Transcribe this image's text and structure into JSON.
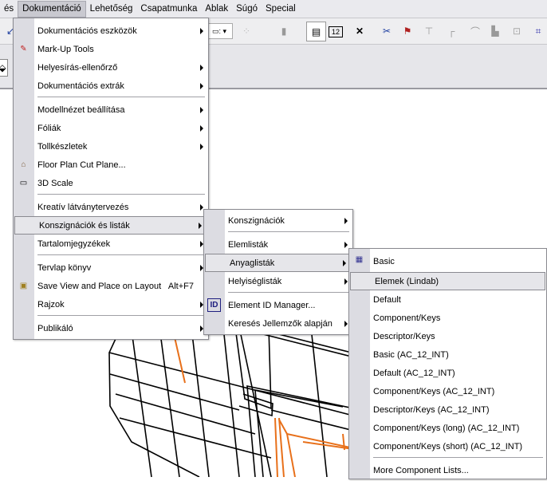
{
  "menubar": {
    "items": [
      "és",
      "Dokumentáció",
      "Lehetőség",
      "Csapatmunka",
      "Ablak",
      "Súgó",
      "Special"
    ],
    "active": "Dokumentáció"
  },
  "main_menu": {
    "items": [
      {
        "label": "Dokumentációs eszközök",
        "submenu": true
      },
      {
        "label": "Mark-Up Tools",
        "icon": "markup-pen-icon"
      },
      {
        "label": "Helyesírás-ellenőrző",
        "submenu": true
      },
      {
        "label": "Dokumentációs extrák",
        "submenu": true
      },
      {
        "separator": true
      },
      {
        "label": "Modellnézet beállítása",
        "submenu": true
      },
      {
        "label": "Fóliák",
        "submenu": true
      },
      {
        "label": "Tollkészletek",
        "submenu": true
      },
      {
        "label": "Floor Plan Cut Plane...",
        "icon": "cut-plane-icon"
      },
      {
        "label": "3D Scale",
        "icon": "ruler-icon"
      },
      {
        "separator": true
      },
      {
        "label": "Kreatív látványtervezés",
        "submenu": true
      },
      {
        "label": "Konszignációk és listák",
        "submenu": true,
        "highlighted": true
      },
      {
        "label": "Tartalomjegyzékek",
        "submenu": true
      },
      {
        "separator": true
      },
      {
        "label": "Tervlap könyv",
        "submenu": true
      },
      {
        "label": "Save View and Place on Layout",
        "shortcut": "Alt+F7",
        "icon": "save-view-icon"
      },
      {
        "label": "Rajzok",
        "submenu": true
      },
      {
        "separator": true
      },
      {
        "label": "Publikáló",
        "submenu": true
      }
    ]
  },
  "sub_menu": {
    "items": [
      {
        "label": "Konszignációk",
        "submenu": true
      },
      {
        "separator": true
      },
      {
        "label": "Elemlisták",
        "submenu": true
      },
      {
        "label": "Anyaglisták",
        "submenu": true,
        "highlighted": true
      },
      {
        "label": "Helyiséglisták",
        "submenu": true
      },
      {
        "separator": true
      },
      {
        "label": "Element ID Manager...",
        "icon": "id-icon"
      },
      {
        "label": "Keresés Jellemzők alapján",
        "submenu": true
      }
    ]
  },
  "list_menu": {
    "items": [
      {
        "label": "Basic",
        "icon": "list-calculator-icon"
      },
      {
        "label": "Elemek (Lindab)",
        "highlighted": true
      },
      {
        "label": "Default"
      },
      {
        "label": "Component/Keys"
      },
      {
        "label": "Descriptor/Keys"
      },
      {
        "label": "Basic (AC_12_INT)"
      },
      {
        "label": "Default (AC_12_INT)"
      },
      {
        "label": "Component/Keys (AC_12_INT)"
      },
      {
        "label": "Descriptor/Keys (AC_12_INT)"
      },
      {
        "label": "Component/Keys (long) (AC_12_INT)"
      },
      {
        "label": "Component/Keys (short) (AC_12_INT)"
      },
      {
        "separator": true
      },
      {
        "label": "More Component Lists..."
      }
    ]
  },
  "colors": {
    "highlight": "#e6e6ea",
    "gutter": "#dcdce2",
    "accent_orange": "#e8701a"
  }
}
